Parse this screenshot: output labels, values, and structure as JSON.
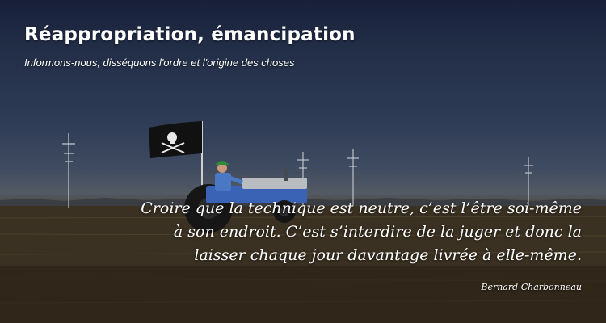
{
  "header": {
    "title": "Réappropriation, émancipation",
    "tagline": "Informons-nous, disséquons l'ordre et l'origine des choses"
  },
  "quote": {
    "lines": [
      "Croire que la technique est neutre, c’est l’être soi-même",
      "à son endroit. C’est s’interdire de la juger et donc la",
      "laisser chaque jour davantage livrée à elle-même."
    ],
    "author": "Bernard Charbonneau"
  },
  "colors": {
    "text": "#ffffff",
    "sky_dark": "#18203a",
    "horizon": "#535a63",
    "field": "#3b3224",
    "tractor_blue": "#3b63b5",
    "tractor_grey": "#b9bcc0",
    "flag": "#111111"
  }
}
